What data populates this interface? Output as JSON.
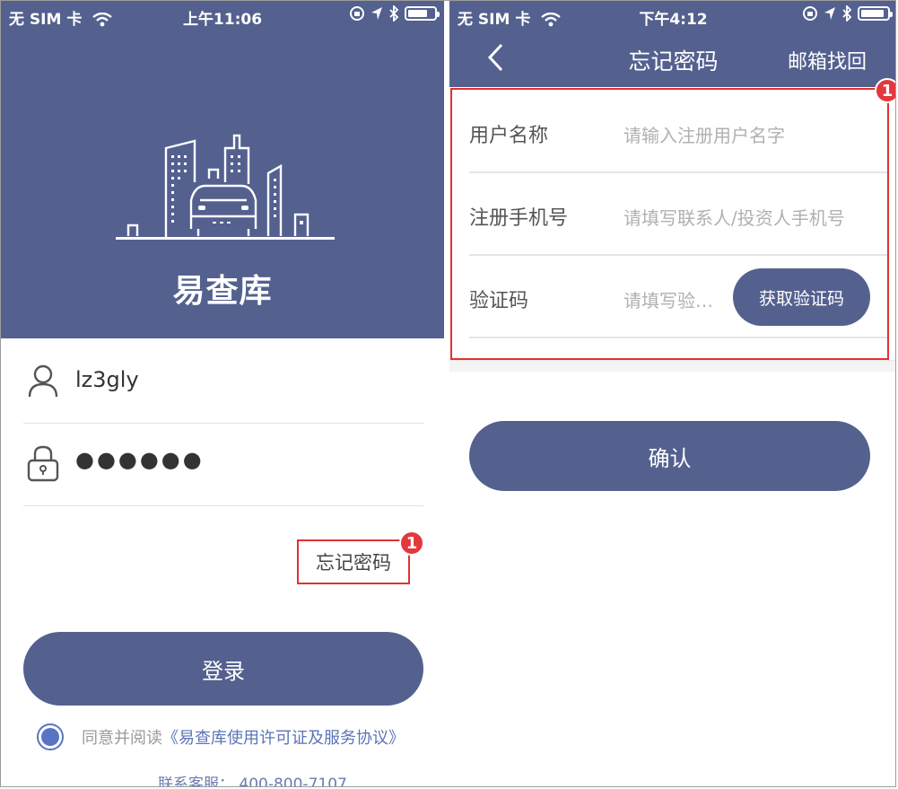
{
  "left": {
    "status_bar": {
      "carrier": "无 SIM 卡",
      "time": "上午11:06"
    },
    "app_name": "易查库",
    "username_value": "lz3gly",
    "password_masked": "●●●●●●",
    "forgot_label": "忘记密码",
    "badge_number": "1",
    "login_label": "登录",
    "agree_prefix": "同意并阅读",
    "agree_link": "《易查库使用许可证及服务协议》",
    "contact_text": "联系客服：  400-800-7107",
    "colors": {
      "brand": "#54618f",
      "highlight": "#e03232",
      "radio": "#5a74c4"
    },
    "battery_level": 0.75
  },
  "right": {
    "status_bar": {
      "carrier": "无 SIM 卡",
      "time": "下午4:12"
    },
    "nav_title": "忘记密码",
    "nav_right": "邮箱找回",
    "badge_number": "1",
    "fields": [
      {
        "label": "用户名称",
        "placeholder": "请输入注册用户名字"
      },
      {
        "label": "注册手机号",
        "placeholder": "请填写联系人/投资人手机号"
      },
      {
        "label": "验证码",
        "placeholder": "请填写验…"
      }
    ],
    "send_code_label": "获取验证码",
    "confirm_label": "确认",
    "battery_level": 0.9
  }
}
